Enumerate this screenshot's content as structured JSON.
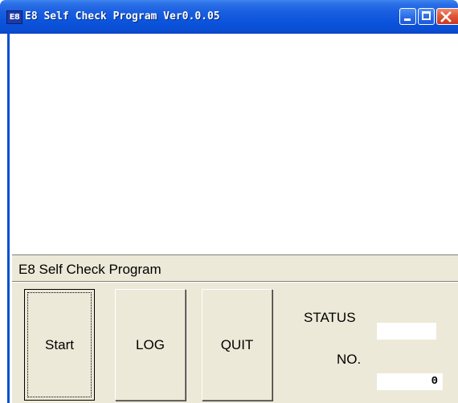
{
  "window": {
    "app_icon_text": "E8",
    "title": "E8 Self Check Program Ver0.0.05",
    "controls": {
      "minimize": "minimize-icon",
      "maximize": "maximize-icon",
      "close": "close-icon"
    },
    "colors": {
      "titlebar": "#0a4ed4",
      "close_button": "#e0583a",
      "panel_background": "#ece9d8"
    }
  },
  "panel": {
    "title": "E8 Self Check Program",
    "buttons": {
      "start": "Start",
      "log": "LOG",
      "quit": "QUIT"
    },
    "status_label": "STATUS",
    "status_value": "",
    "no_label": "NO.",
    "no_value": "0"
  }
}
